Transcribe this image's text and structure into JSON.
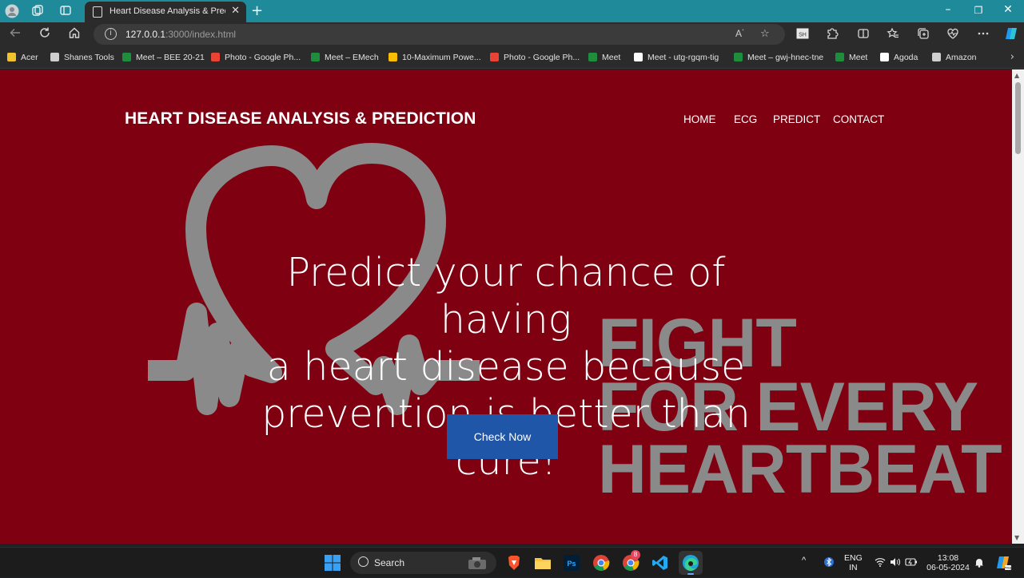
{
  "browser": {
    "tab_title": "Heart Disease Analysis & Predicti",
    "close_glyph": "✕",
    "new_tab_glyph": "+",
    "window_controls": {
      "minimize": "–",
      "maximize": "❐",
      "close": "✕"
    },
    "url_host": "127.0.0.1",
    "url_rest": ":3000/index.html",
    "info_glyph": "i",
    "bookmarks": [
      {
        "label": "Acer",
        "icon": "folder-icon",
        "color": "#f2c12e"
      },
      {
        "label": "Shanes Tools",
        "icon": "page-icon",
        "color": "#cfcfcf"
      },
      {
        "label": "Meet – BEE 20-21",
        "icon": "meet-icon",
        "color": "#1e8e3e"
      },
      {
        "label": "Photo - Google Ph...",
        "icon": "photos-icon",
        "color": "#ea4335"
      },
      {
        "label": "Meet – EMech",
        "icon": "meet-icon",
        "color": "#1e8e3e"
      },
      {
        "label": "10-Maximum Powe...",
        "icon": "drive-icon",
        "color": "#fbbc04"
      },
      {
        "label": "Photo - Google Ph...",
        "icon": "photos-icon",
        "color": "#ea4335"
      },
      {
        "label": "Meet",
        "icon": "meet-icon",
        "color": "#1e8e3e"
      },
      {
        "label": "Meet - utg-rgqm-tig",
        "icon": "google-icon",
        "color": "#ffffff"
      },
      {
        "label": "Meet – gwj-hnec-tne",
        "icon": "meet-icon",
        "color": "#1e8e3e"
      },
      {
        "label": "Meet",
        "icon": "meet-icon",
        "color": "#1e8e3e"
      },
      {
        "label": "Agoda",
        "icon": "agoda-icon",
        "color": "#ffffff"
      },
      {
        "label": "Amazon",
        "icon": "page-icon",
        "color": "#cfcfcf"
      }
    ],
    "bookmarks_more": "›"
  },
  "site": {
    "brand": "HEART DISEASE ANALYSIS & PREDICTION",
    "nav": [
      "HOME",
      "ECG",
      "PREDICT",
      "CONTACT"
    ],
    "hero_lines": [
      "Predict your chance of having",
      "a heart disease because",
      "prevention is better than cure!"
    ],
    "cta": "Check Now",
    "bg_text_lines": [
      "FIGHT",
      "FOR EVERY",
      "HEARTBEAT"
    ],
    "colors": {
      "background": "#7e0011",
      "cta": "#1f56a8",
      "art": "#8a8a8a"
    }
  },
  "taskbar": {
    "search_label": "Search",
    "lang_top": "ENG",
    "lang_bottom": "IN",
    "time": "13:08",
    "date": "06-05-2024",
    "chrome_badge": "8"
  }
}
